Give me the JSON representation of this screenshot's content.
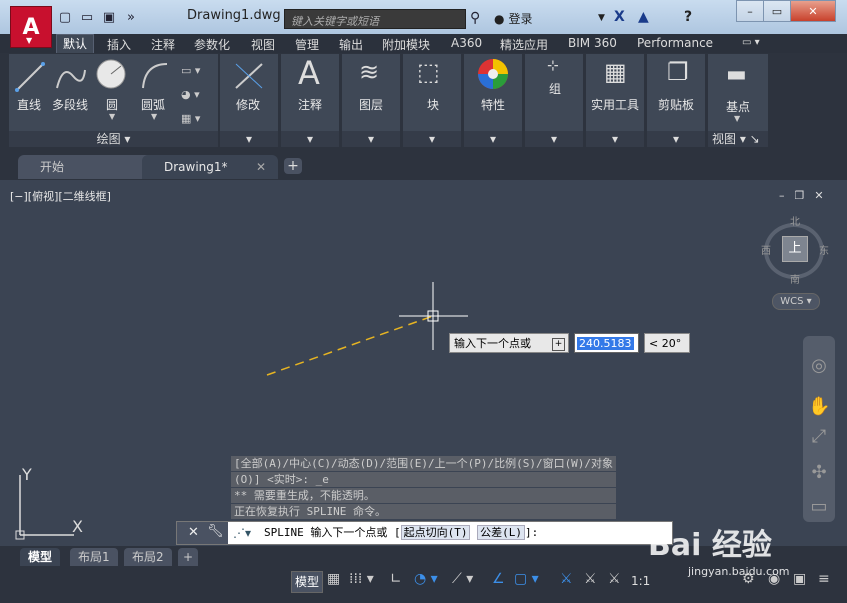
{
  "titlebar": {
    "doc_title": "Drawing1.dwg",
    "search_placeholder": "键入关键字或短语",
    "login_label": "登录"
  },
  "ribbon_tabs": [
    "默认",
    "插入",
    "注释",
    "参数化",
    "视图",
    "管理",
    "输出",
    "附加模块",
    "A360",
    "精选应用",
    "BIM 360",
    "Performance"
  ],
  "ribbon": {
    "draw": {
      "line": "直线",
      "polyline": "多段线",
      "circle": "圆",
      "arc": "圆弧",
      "footer": "绘图"
    },
    "modify": "修改",
    "annotation": "注释",
    "layers": "图层",
    "block": "块",
    "properties": "特性",
    "groups": "组",
    "utilities": "实用工具",
    "clipboard": "剪贴板",
    "view": {
      "base": "基点",
      "footer": "视图"
    }
  },
  "file_tabs": {
    "start": "开始",
    "drawing": "Drawing1*"
  },
  "viewport": {
    "label": "[−][俯视][二维线框]",
    "viewcube": {
      "top": "上",
      "north": "北",
      "south": "南",
      "east": "东",
      "west": "西",
      "wcs": "WCS"
    }
  },
  "dynamic_input": {
    "prompt": "输入下一个点或",
    "length": "240.5183",
    "angle": "< 20°"
  },
  "ucs": {
    "x": "X",
    "y": "Y"
  },
  "command_history": [
    "[全部(A)/中心(C)/动态(D)/范围(E)/上一个(P)/比例(S)/窗口(W)/对象",
    "(O)] <实时>: _e",
    "** 需要重生成，不能透明。",
    "正在恢复执行 SPLINE 命令。"
  ],
  "command_line": {
    "text": "SPLINE 输入下一个点或 [",
    "opt1": "起点切向(T)",
    "opt2": "公差(L)",
    "suffix": "]:"
  },
  "layout_tabs": [
    "模型",
    "布局1",
    "布局2"
  ],
  "status": {
    "model": "模型",
    "scale": "1:1"
  },
  "watermark": {
    "main": "Bai 经验",
    "sub": "jingyan.baidu.com"
  }
}
